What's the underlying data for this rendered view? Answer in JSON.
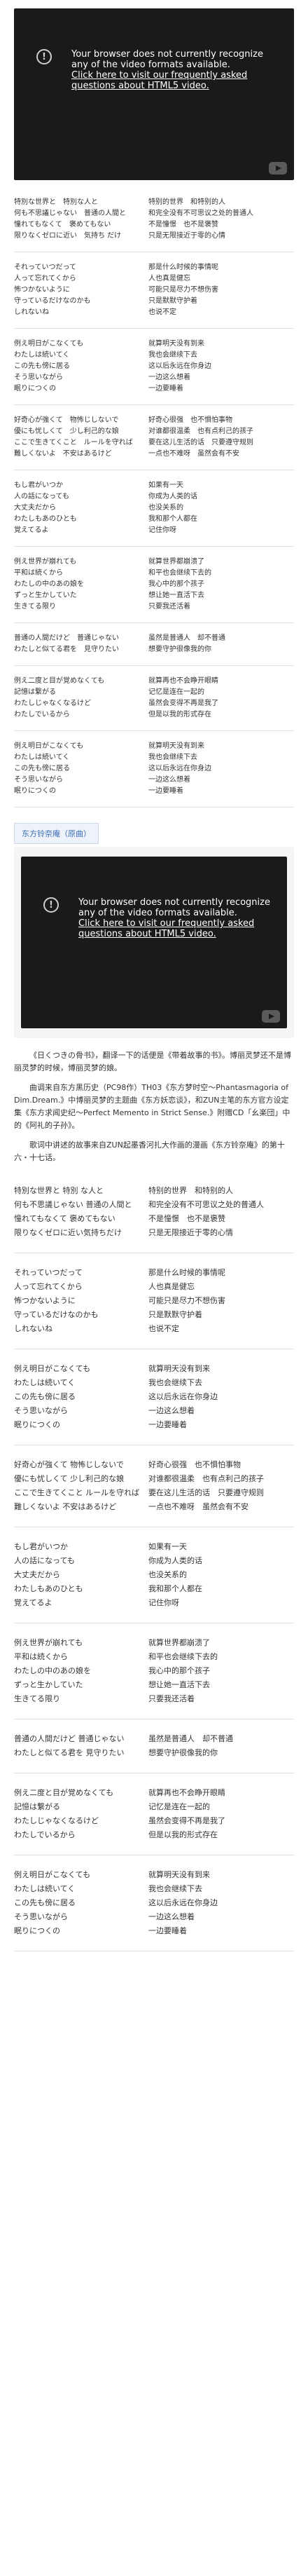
{
  "video_error": {
    "message": "Your browser does not currently recognize any of the video formats available.",
    "link": "Click here to visit our frequently asked questions about HTML5 video."
  },
  "lyrics_top": [
    {
      "jp": [
        "特別な世界と　特別な人と",
        "何も不思議じゃない　普通の人間と",
        "憧れてもなくて　褒めてもない",
        "限りなくゼロに近い　気持ち だけ"
      ],
      "cn": [
        "特别的世界　和特别的人",
        "和完全没有不可思议之处的普通人",
        "不是憧憬　也不是褒赞",
        "只是无限接近于零的心情"
      ]
    },
    {
      "jp": [
        "それっていつだって",
        "人って忘れてくから",
        "怖つかないように",
        "守っているだけなのかも",
        "しれないね"
      ],
      "cn": [
        "那是什么时候的事情呢",
        "人也真是健忘",
        "可能只是尽力不想伤害",
        "只是默默守护着",
        "也说不定"
      ]
    },
    {
      "jp": [
        "例え明日がこなくても",
        "わたしは続いてく",
        "この先も傍に居る",
        "そう思いながら",
        "眠りにつくの"
      ],
      "cn": [
        "就算明天没有到来",
        "我也会继续下去",
        "这以后永远在你身边",
        "一边这么想着",
        "一边要睡着"
      ]
    },
    {
      "jp": [
        "好奇心が強くて　物怖じしないで",
        "優にも忧しくて　少し利己的な娘",
        "ここで生きてくこと　ルールを守れば",
        "難しくないよ　不安はあるけど"
      ],
      "cn": [
        "好奇心很强　也不惧怕事物",
        "对谁都很温柔　也有点利己的孩子",
        "要在这儿生活的话　只要遵守规则",
        "一点也不难呀　虽然会有不安"
      ]
    },
    {
      "jp": [
        "もし君がいつか",
        "人の話になっても",
        "大丈夫だから",
        "わたしもあのひとも",
        "覚えてるよ"
      ],
      "cn": [
        "如果有一天",
        "你成为人类的话",
        "也没关系的",
        "我和那个人都在",
        "记住你呀"
      ]
    },
    {
      "jp": [
        "例え世界が崩れても",
        "平和は続くから",
        "わたしの中のあの娘を",
        "ずっと生かしていた",
        "生きてる限り"
      ],
      "cn": [
        "就算世界都崩溃了",
        "和平也会继续下去的",
        "我心中的那个孩子",
        "想让她一直活下去",
        "只要我还活着"
      ]
    },
    {
      "jp": [
        "普通の人間だけど　普通じゃない",
        "わたしと似てる君を　見守りたい"
      ],
      "cn": [
        "虽然是普通人　却不普通",
        "想要守护很像我的你"
      ]
    },
    {
      "jp": [
        "例え二度と目が覚めなくても",
        "記憶は繋がる",
        "わたしじゃなくなるけど",
        "わたしでいるから"
      ],
      "cn": [
        "就算再也不会睁开眼睛",
        "记忆是连在一起的",
        "虽然会变得不再是我了",
        "但是以我的形式存在"
      ]
    },
    {
      "jp": [
        "例え明日がこなくても",
        "わたしは続いてく",
        "この先も傍に居る",
        "そう思いながら",
        "眠りにつくの"
      ],
      "cn": [
        "就算明天没有到来",
        "我也会继续下去",
        "这以后永远在你身边",
        "一边这么想着",
        "一边要睡着"
      ]
    }
  ],
  "section_title": "东方铃奈庵（原曲）",
  "video_error2": {
    "message": "Your browser does not currently recognize any of the video formats available.",
    "link": "Click here to visit our frequently asked questions about HTML5 video."
  },
  "prose": [
    "《日くつきの骨书》，翻译一下的话便是《带着故事的书》。博丽灵梦还不是博丽灵梦的时候，博丽灵梦的娘。",
    "曲调来自东方黑历史（PC98作）TH03《东方梦时空～Phantasmagoria of Dim.Dream.》中博丽灵梦的主题曲《东方妖恋谈》，和ZUN主笔的东方官方设定集《东方求闻史纪～Perfect Memento in Strict Sense.》附赠CD「幺楽団」中的《阿礼的子孙》。",
    "歌词中讲述的故事来自ZUN起墨香河扎大作画的漫画《东方铃奈庵》的第十六・十七话。"
  ],
  "lyrics_bottom": [
    {
      "jp": [
        "特別な世界と 特別 な人と",
        "何も不思議じゃない 普通の人間と",
        "憧れてもなくて 褒めてもない",
        "限りなくゼロに近い気持ちだけ"
      ],
      "cn": [
        "特别的世界　和特别的人",
        "和完全没有不可思议之处的普通人",
        "不是憧憬　也不是褒赞",
        "只是无限接近于零的心情"
      ]
    },
    {
      "jp": [
        "それっていつだって",
        "人って忘れてくから",
        "怖つかないように",
        "守っているだけなのかも",
        "しれないね"
      ],
      "cn": [
        "那是什么时候的事情呢",
        "人也真是健忘",
        "可能只是尽力不想伤害",
        "只是默默守护着",
        "也说不定"
      ]
    },
    {
      "jp": [
        "例え明日がこなくても",
        "わたしは続いてく",
        "この先も傍に居る",
        "そう思いながら",
        "眠りにつくの"
      ],
      "cn": [
        "就算明天没有到来",
        "我也会继续下去",
        "这以后永远在你身边",
        "一边这么想着",
        "一边要睡着"
      ]
    },
    {
      "jp": [
        "好奇心が強くて 物怖じしないで",
        "優にも忧しくて 少し利己的な娘",
        "ここで生きてくこと ルールを守れば",
        "難しくないよ 不安はあるけど"
      ],
      "cn": [
        "好奇心很强　也不惧怕事物",
        "对谁都很温柔　也有点利己的孩子",
        "要在这儿生活的话　只要遵守规则",
        "一点也不难呀　虽然会有不安"
      ]
    },
    {
      "jp": [
        "もし君がいつか",
        "人の話になっても",
        "大丈夫だから",
        "わたしもあのひとも",
        "覚えてるよ"
      ],
      "cn": [
        "如果有一天",
        "你成为人类的话",
        "也没关系的",
        "我和那个人都在",
        "记住你呀"
      ]
    },
    {
      "jp": [
        "例え世界が崩れても",
        "平和は続くから",
        "わたしの中のあの娘を",
        "ずっと生かしていた",
        "生きてる限り"
      ],
      "cn": [
        "就算世界都崩溃了",
        "和平也会继续下去的",
        "我心中的那个孩子",
        "想让她一直活下去",
        "只要我还活着"
      ]
    },
    {
      "jp": [
        "普通の人間だけど 普通じゃない",
        "わたしと似てる君を 見守りたい"
      ],
      "cn": [
        "虽然是普通人　却不普通",
        "想要守护很像我的你"
      ]
    },
    {
      "jp": [
        "例え二度と目が覚めなくても",
        "記憶は繋がる",
        "わたしじゃなくなるけど",
        "わたしでいるから"
      ],
      "cn": [
        "就算再也不会睁开眼睛",
        "记忆是连在一起的",
        "虽然会变得不再是我了",
        "但是以我的形式存在"
      ]
    },
    {
      "jp": [
        "例え明日がこなくても",
        "わたしは続いてく",
        "この先も傍に居る",
        "そう思いながら",
        "眠りにつくの"
      ],
      "cn": [
        "就算明天没有到来",
        "我也会继续下去",
        "这以后永远在你身边",
        "一边这么想着",
        "一边要睡着"
      ]
    }
  ]
}
